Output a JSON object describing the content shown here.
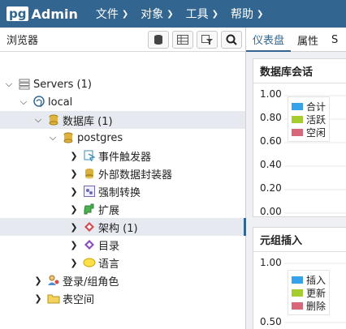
{
  "app": {
    "logo_pg": "pg",
    "logo_admin": "Admin"
  },
  "menu": [
    {
      "label": "文件"
    },
    {
      "label": "对象"
    },
    {
      "label": "工具"
    },
    {
      "label": "帮助"
    }
  ],
  "browser": {
    "title": "浏览器",
    "toolbar_icons": [
      "query-tool-icon",
      "view-data-icon",
      "filter-rows-icon",
      "search-objects-icon"
    ]
  },
  "tree": [
    {
      "label": "Servers (1)",
      "icon": "servers-icon"
    },
    {
      "label": "local",
      "icon": "postgres-server-icon"
    },
    {
      "label": "数据库 (1)",
      "icon": "databases-icon"
    },
    {
      "label": "postgres",
      "icon": "database-icon"
    },
    {
      "label": "事件触发器",
      "icon": "event-trigger-icon"
    },
    {
      "label": "外部数据封装器",
      "icon": "fdw-icon"
    },
    {
      "label": "强制转换",
      "icon": "cast-icon"
    },
    {
      "label": "扩展",
      "icon": "extension-icon"
    },
    {
      "label": "架构 (1)",
      "icon": "schemas-icon"
    },
    {
      "label": "目录",
      "icon": "catalog-icon"
    },
    {
      "label": "语言",
      "icon": "language-icon"
    },
    {
      "label": "登录/组角色",
      "icon": "login-roles-icon"
    },
    {
      "label": "表空间",
      "icon": "tablespaces-icon"
    }
  ],
  "tabs": [
    {
      "label": "仪表盘"
    },
    {
      "label": "属性"
    },
    {
      "label": "S"
    }
  ],
  "sessions_card": {
    "title": "数据库会话",
    "y_labels": [
      "1.00",
      "0.80",
      "0.60",
      "0.40",
      "0.20",
      "0.00"
    ],
    "legend": [
      {
        "label": "合计",
        "color": "#36a2eb"
      },
      {
        "label": "活跃",
        "color": "#a6cd2f"
      },
      {
        "label": "空闲",
        "color": "#d8677a"
      }
    ]
  },
  "tuples_card": {
    "title": "元组插入",
    "y_labels": [
      "1.00",
      "0.50"
    ],
    "legend": [
      {
        "label": "插入",
        "color": "#36a2eb"
      },
      {
        "label": "更新",
        "color": "#a6cd2f"
      },
      {
        "label": "删除",
        "color": "#d8677a"
      }
    ]
  }
}
